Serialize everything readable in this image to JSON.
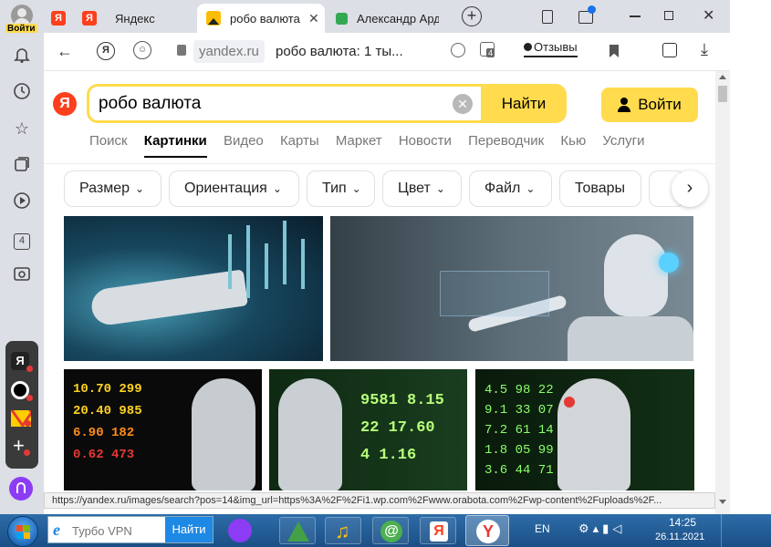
{
  "profile": {
    "login_label": "Войти"
  },
  "tabs": [
    {
      "title": "Яндекс"
    },
    {
      "title": "робо валюта"
    },
    {
      "title": "Александр Ард"
    }
  ],
  "toolbar": {
    "domain": "yandex.ru",
    "page_title": "робо валюта: 1 ты...",
    "reviews_label": "Отзывы",
    "badge_count": "4"
  },
  "search": {
    "logo": "Я",
    "query": "робо валюта",
    "submit_label": "Найти",
    "login_label": "Войти"
  },
  "nav": [
    "Поиск",
    "Картинки",
    "Видео",
    "Карты",
    "Маркет",
    "Новости",
    "Переводчик",
    "Кью",
    "Услуги"
  ],
  "filters": [
    "Размер",
    "Ориентация",
    "Тип",
    "Цвет",
    "Файл",
    "Товары"
  ],
  "sidebar": {
    "badge_count": "4",
    "ya_label": "Я"
  },
  "status_url": "https://yandex.ru/images/search?pos=14&img_url=https%3A%2F%2Fi1.wp.com%2Fwww.orabota.com%2Fwp-content%2Fuploads%2F...",
  "taskbar": {
    "search_placeholder": "Турбо VPN",
    "search_button": "Найти",
    "lang": "EN",
    "time": "14:25",
    "date": "26.11.2021"
  },
  "colors": {
    "yandex_red": "#fc3f1d",
    "yandex_yellow": "#ffdb4d",
    "taskbar": "#1b4f86"
  }
}
